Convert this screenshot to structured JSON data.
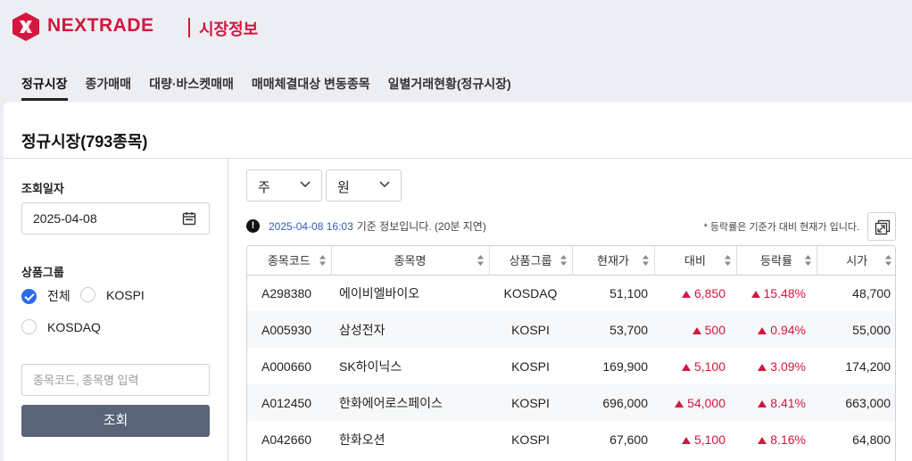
{
  "brand": {
    "logo_text": "NEXTRADE",
    "sub_title": "시장정보",
    "color": "#d3173f"
  },
  "tabs": [
    {
      "label": "정규시장",
      "active": true
    },
    {
      "label": "종가매매",
      "active": false
    },
    {
      "label": "대량·바스켓매매",
      "active": false
    },
    {
      "label": "매매체결대상 변동종목",
      "active": false
    },
    {
      "label": "일별거래현황(정규시장)",
      "active": false
    }
  ],
  "panel": {
    "title": "정규시장(793종목)"
  },
  "sidebar": {
    "date_label": "조회일자",
    "date_value": "2025-04-08",
    "group_label": "상품그룹",
    "options": [
      {
        "label": "전체",
        "checked": true
      },
      {
        "label": "KOSPI",
        "checked": false
      },
      {
        "label": "KOSDAQ",
        "checked": false
      }
    ],
    "search_placeholder": "종목코드, 종목명 입력",
    "search_button": "조회"
  },
  "filters": {
    "unit_shares": "주",
    "unit_currency": "원"
  },
  "info": {
    "date": "2025-04-08 16:03",
    "text": "기준 정보입니다. (20분 지연)",
    "note": "* 등락률은 기준가 대비 현재가 입니다."
  },
  "table": {
    "headers": [
      "종목코드",
      "종목명",
      "상품그룹",
      "현재가",
      "대비",
      "등락률",
      "시가"
    ],
    "rows": [
      {
        "code": "A298380",
        "name": "에이비엘바이오",
        "group": "KOSDAQ",
        "price": "51,100",
        "change": "6,850",
        "rate": "15.48%",
        "open": "48,700"
      },
      {
        "code": "A005930",
        "name": "삼성전자",
        "group": "KOSPI",
        "price": "53,700",
        "change": "500",
        "rate": "0.94%",
        "open": "55,000"
      },
      {
        "code": "A000660",
        "name": "SK하이닉스",
        "group": "KOSPI",
        "price": "169,900",
        "change": "5,100",
        "rate": "3.09%",
        "open": "174,200"
      },
      {
        "code": "A012450",
        "name": "한화에어로스페이스",
        "group": "KOSPI",
        "price": "696,000",
        "change": "54,000",
        "rate": "8.41%",
        "open": "663,000"
      },
      {
        "code": "A042660",
        "name": "한화오션",
        "group": "KOSPI",
        "price": "67,600",
        "change": "5,100",
        "rate": "8.16%",
        "open": "64,800"
      }
    ]
  }
}
